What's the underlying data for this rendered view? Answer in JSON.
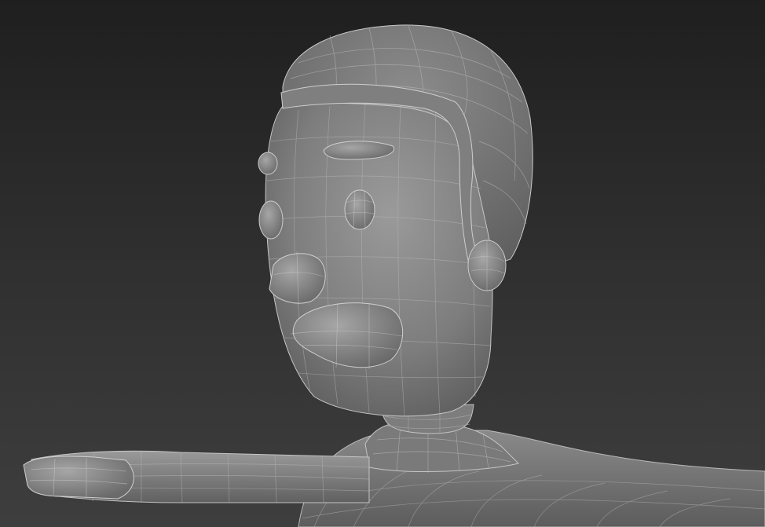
{
  "viewport": {
    "shading_mode": "smooth-shaded-with-wireframe-overlay",
    "background_color": "#2a2a2a",
    "mesh_color": "#8a8a8a",
    "wire_color": "#c8c8c8"
  },
  "model": {
    "parts": [
      "hair",
      "head",
      "ears",
      "eyebrow",
      "eye",
      "nose",
      "mouth",
      "neck",
      "collar",
      "torso",
      "left-arm",
      "hand"
    ]
  }
}
